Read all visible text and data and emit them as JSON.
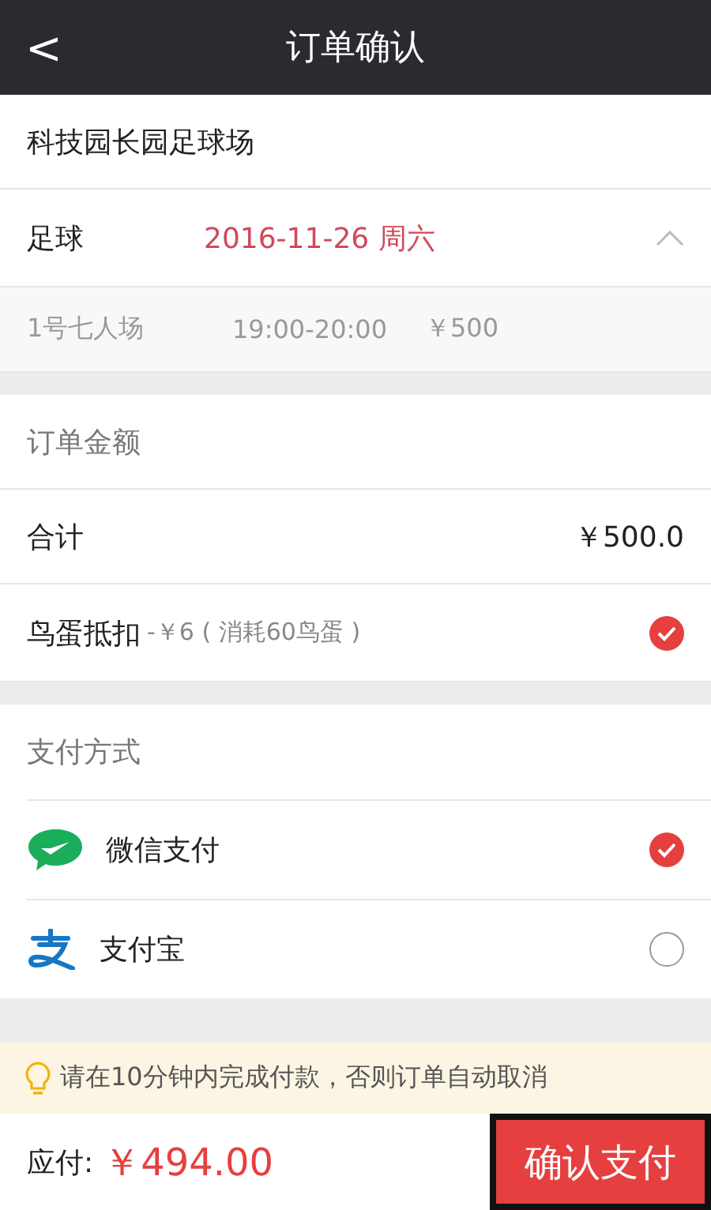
{
  "header": {
    "back": "<",
    "title": "订单确认"
  },
  "venue": "科技园长园足球场",
  "booking": {
    "sport": "足球",
    "date": "2016-11-26 周六",
    "expanded": true,
    "slot": {
      "court": "1号七人场",
      "time": "19:00-20:00",
      "price": "￥500"
    }
  },
  "order": {
    "title": "订单金额",
    "total_label": "合计",
    "total": "￥500.0",
    "discount": {
      "label": "鸟蛋抵扣",
      "detail": "-￥6 ( 消耗60鸟蛋 )",
      "checked": true
    }
  },
  "payment": {
    "title": "支付方式",
    "methods": [
      {
        "kind": "wechat",
        "label": "微信支付",
        "selected": true
      },
      {
        "kind": "alipay",
        "label": "支付宝",
        "selected": false
      }
    ]
  },
  "tip": "请在10分钟内完成付款，否则订单自动取消",
  "footer": {
    "due_label": "应付:",
    "due": "￥494.00",
    "button": "确认支付"
  }
}
